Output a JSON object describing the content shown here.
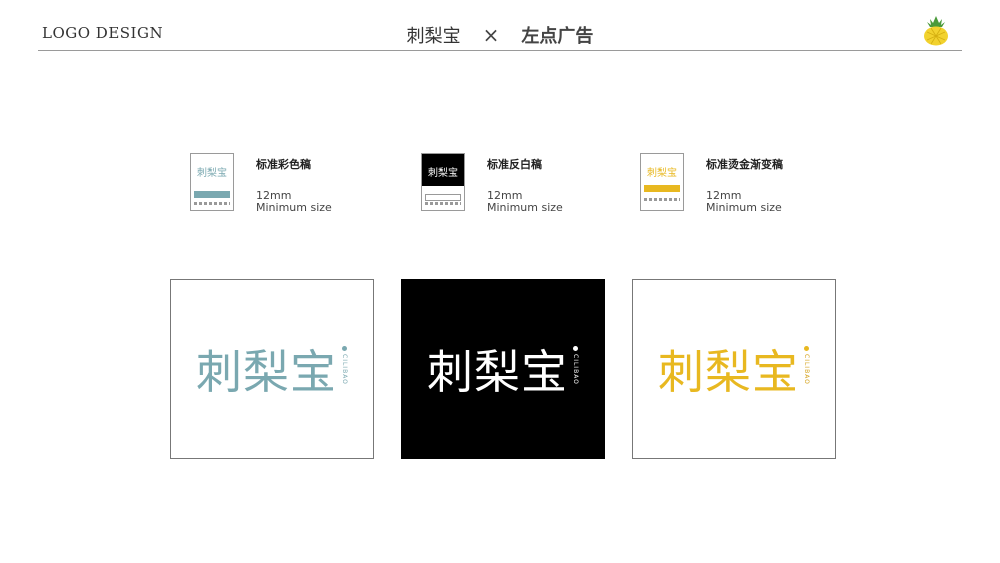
{
  "header": {
    "left_title": "LOGO DESIGN",
    "brand_a": "刺梨宝",
    "times": "×",
    "brand_b": "左点广告"
  },
  "specs": [
    {
      "title": "标准彩色稿",
      "size": "12mm",
      "caption": "Minimum size",
      "thumb_text": "刺梨宝"
    },
    {
      "title": "标准反白稿",
      "size": "12mm",
      "caption": "Minimum size",
      "thumb_text": "刺梨宝"
    },
    {
      "title": "标准烫金渐变稿",
      "size": "12mm",
      "caption": "Minimum size",
      "thumb_text": "刺梨宝"
    }
  ],
  "logos": [
    {
      "word": "刺梨宝",
      "tag": "CILIBAO",
      "color": "#7aa8b0",
      "bg": "#ffffff"
    },
    {
      "word": "刺梨宝",
      "tag": "CILIBAO",
      "color": "#ffffff",
      "bg": "#000000"
    },
    {
      "word": "刺梨宝",
      "tag": "CILIBAO",
      "color": "#e8b820",
      "bg": "#ffffff"
    }
  ],
  "colors": {
    "accent_blue": "#7aa8b0",
    "gold": "#e8b820",
    "pineapple": "#f2d22e"
  },
  "icons": {
    "header_right": "pineapple-icon"
  }
}
